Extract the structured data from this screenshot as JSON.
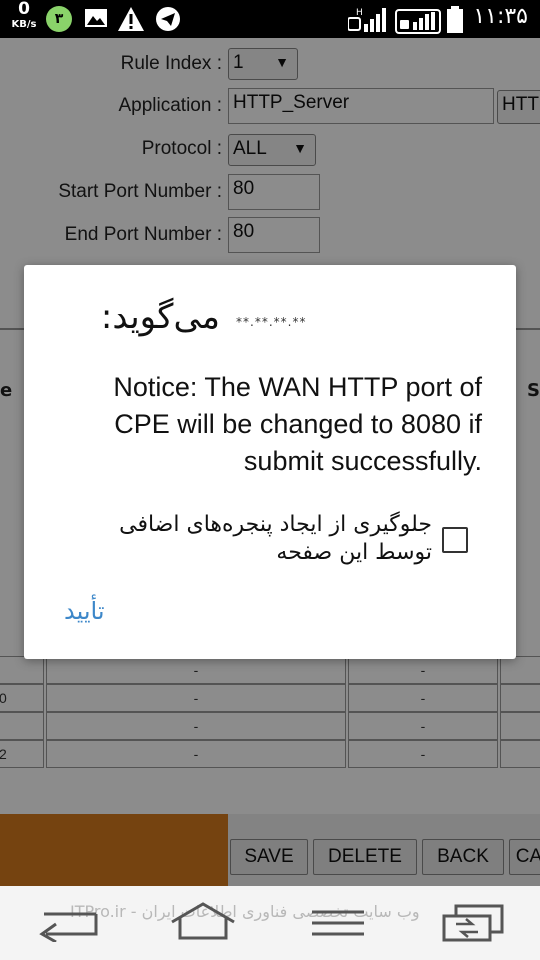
{
  "status_bar": {
    "speed_value": "0",
    "speed_unit": "KB/s",
    "notification_count": "۳",
    "time": "۱۱:۳۵",
    "icons": [
      "gallery-icon",
      "warning-icon",
      "telegram-icon",
      "signal-icon",
      "wifi-call-icon",
      "battery-icon"
    ]
  },
  "form": {
    "rule_index_label": "Rule Index :",
    "rule_index_value": "1",
    "application_label": "Application :",
    "application_value": "HTTP_Server",
    "application_button": "HTT",
    "protocol_label": "Protocol :",
    "protocol_value": "ALL",
    "start_port_label": "Start Port Number :",
    "start_port_value": "80",
    "end_port_label": "End Port Number :",
    "end_port_value": "80"
  },
  "table": {
    "left_header": "e",
    "right_header": "S",
    "rows": [
      {
        "index": "",
        "col1": "-",
        "col2": "-"
      },
      {
        "index": "0",
        "col1": "-",
        "col2": "-"
      },
      {
        "index": "",
        "col1": "-",
        "col2": "-"
      },
      {
        "index": "2",
        "col1": "-",
        "col2": "-"
      }
    ]
  },
  "buttons": {
    "save": "SAVE",
    "delete": "DELETE",
    "back": "BACK",
    "cancel": "CA"
  },
  "dialog": {
    "title": "می‌گوید:",
    "host": "**.**.**.**",
    "message": "Notice: The WAN HTTP port of CPE will be changed to 8080 if submit successfully.",
    "checkbox_label": "جلوگیری از ایجاد پنجره‌های اضافی توسط این صفحه",
    "checkbox_checked": false,
    "ok_label": "تأیید"
  },
  "nav_bar": {
    "watermark": "ITPro.ir - وب سایت تخصصی فناوری اطلاعات ایران",
    "icons": [
      "back-icon",
      "home-icon",
      "menu-icon",
      "recent-apps-icon"
    ]
  }
}
